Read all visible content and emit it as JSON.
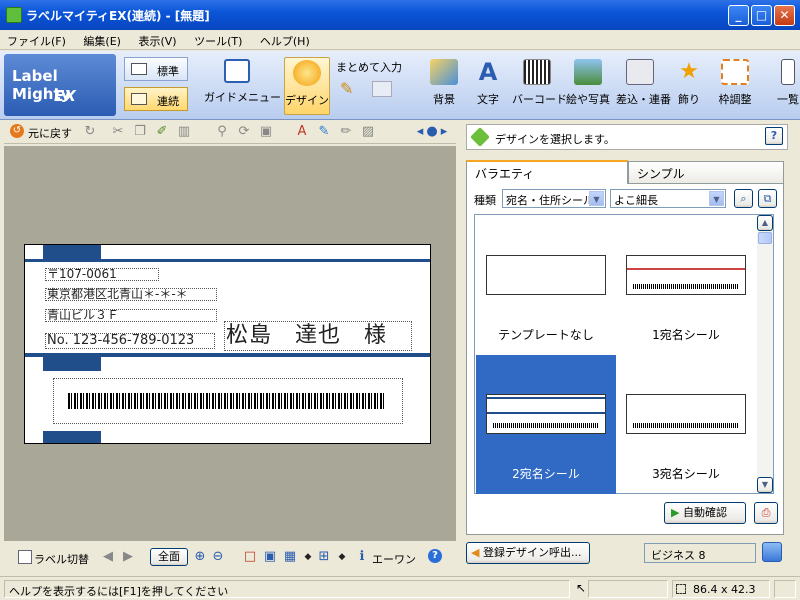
{
  "window": {
    "title": "ラベルマイティEX(連続) - [無題]",
    "min": "_",
    "max": "□",
    "close": "✕"
  },
  "menu": [
    "ファイル(F)",
    "編集(E)",
    "表示(V)",
    "ツール(T)",
    "ヘルプ(H)"
  ],
  "logo": {
    "line1": "Label Mighty",
    "line2": "EX"
  },
  "modes": {
    "standard": "標準",
    "continuous": "連続"
  },
  "ribbon": {
    "guide": "ガイドメニュー",
    "design": "デザイン",
    "bulk_input": "まとめて入力",
    "background": "背景",
    "text": "文字",
    "barcode": "バーコード",
    "picture": "絵や写真",
    "insert_serial": "差込・連番",
    "decoration": "飾り",
    "frame_adjust": "枠調整",
    "list": "一覧"
  },
  "editor": {
    "undo_label": "元に戻す",
    "label": {
      "postcode": "〒107-0061",
      "address1": "東京都港区北青山＊-＊-＊",
      "address2": "青山ビル３Ｆ",
      "number": "No. 123-456-789-0123",
      "name": "松島　達也　様"
    }
  },
  "bottom_toolbar": {
    "switch_label": "ラベル切替",
    "zoom_all": "全面",
    "ewan": "エーワン"
  },
  "design_panel": {
    "hint": "デザインを選択します。",
    "help": "?",
    "tabs": [
      "バラエティ",
      "シンプル"
    ],
    "kind_label": "種類",
    "kind_value": "宛名・住所シール",
    "layout_value": "よこ細長",
    "thumbs": [
      "テンプレートなし",
      "1宛名シール",
      "2宛名シール",
      "3宛名シール"
    ],
    "selected_index": 2,
    "auto_confirm": "自動確認",
    "registered_design": "登録デザイン呼出...",
    "business_field": "ビジネス 8"
  },
  "status": {
    "help_text": "ヘルプを表示するには[F1]を押してください",
    "size": "86.4 x 42.3"
  },
  "colors": {
    "accent": "#316ac5",
    "label_bar": "#1f4e8a",
    "canvas_bg": "#a9a797"
  }
}
